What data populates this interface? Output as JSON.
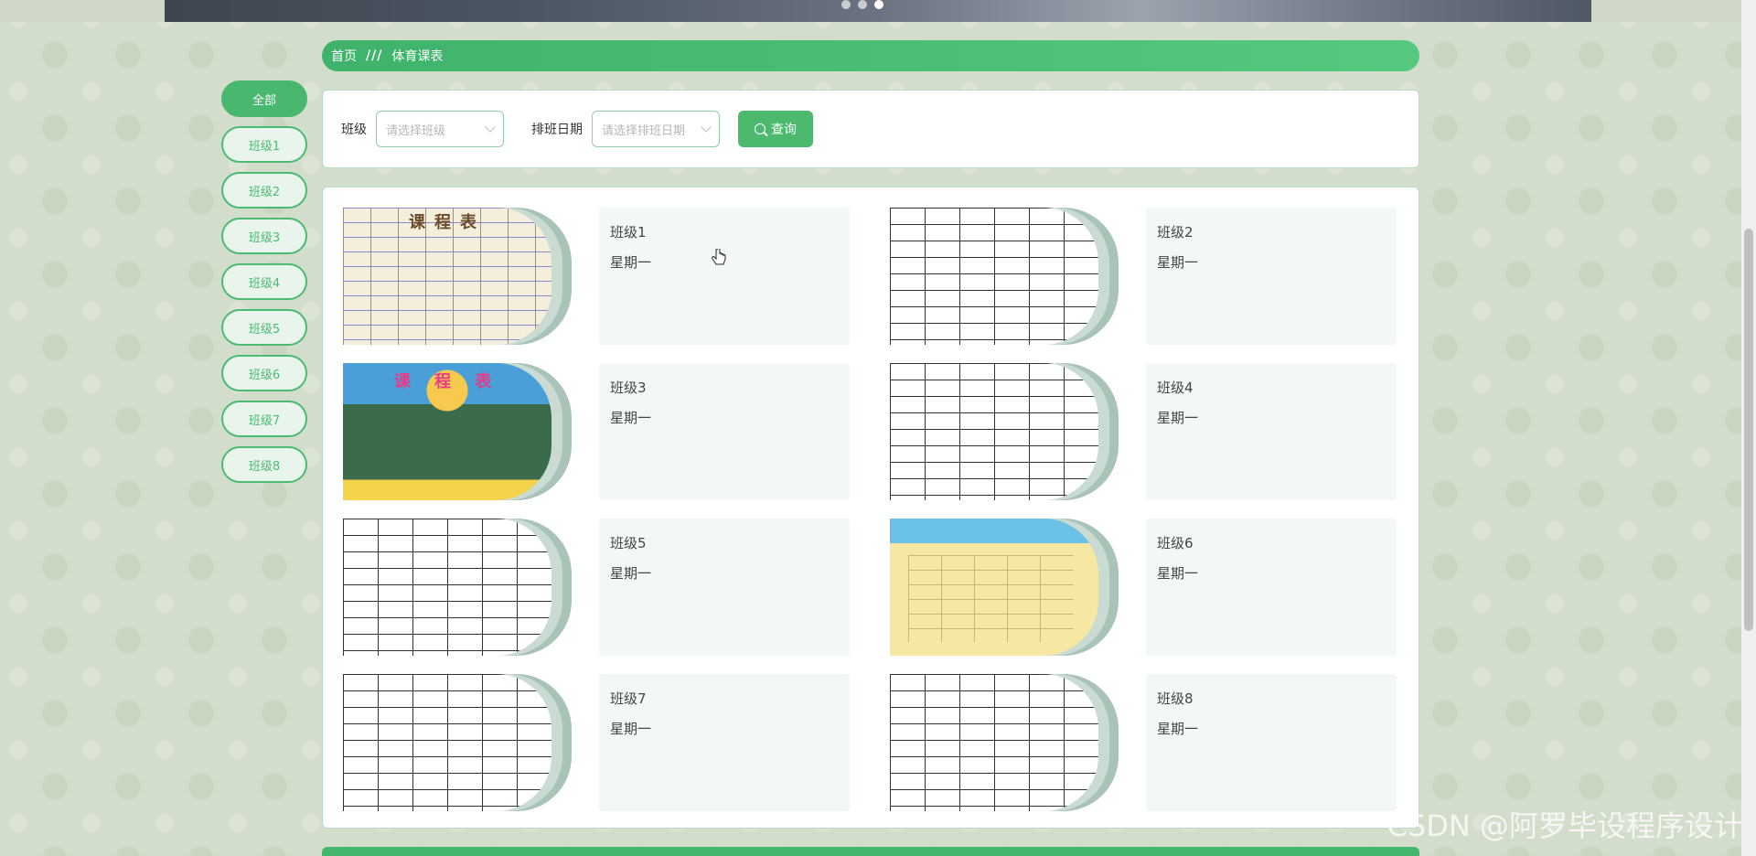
{
  "banner": {
    "slide_count": 3,
    "active_slide": 3
  },
  "breadcrumb": {
    "home": "首页",
    "separator": "///",
    "current": "体育课表"
  },
  "sidebar": {
    "items": [
      "全部",
      "班级1",
      "班级2",
      "班级3",
      "班级4",
      "班级5",
      "班级6",
      "班级7",
      "班级8"
    ],
    "active_index": 0
  },
  "filter": {
    "class_label": "班级",
    "class_placeholder": "请选择班级",
    "date_label": "排班日期",
    "date_placeholder": "请选择排班日期",
    "query_label": "查询"
  },
  "cards": [
    {
      "name": "班级1",
      "day": "星期一",
      "thumb_title": "课程表",
      "thumb_style": "soft"
    },
    {
      "name": "班级2",
      "day": "星期一",
      "thumb_title": "",
      "thumb_style": "grid"
    },
    {
      "name": "班级3",
      "day": "星期一",
      "thumb_title": "课 程 表",
      "thumb_style": "board"
    },
    {
      "name": "班级4",
      "day": "星期一",
      "thumb_title": "",
      "thumb_style": "grid"
    },
    {
      "name": "班级5",
      "day": "星期一",
      "thumb_title": "",
      "thumb_style": "grid"
    },
    {
      "name": "班级6",
      "day": "星期一",
      "thumb_title": "",
      "thumb_style": "yellow"
    },
    {
      "name": "班级7",
      "day": "星期一",
      "thumb_title": "",
      "thumb_style": "grid"
    },
    {
      "name": "班级8",
      "day": "星期一",
      "thumb_title": "",
      "thumb_style": "grid"
    }
  ],
  "watermark": "CSDN @阿罗毕设程序设计",
  "colors": {
    "primary": "#4cb96f",
    "card_bg": "#f1f8f5",
    "page_bg": "#d3ddcb"
  }
}
